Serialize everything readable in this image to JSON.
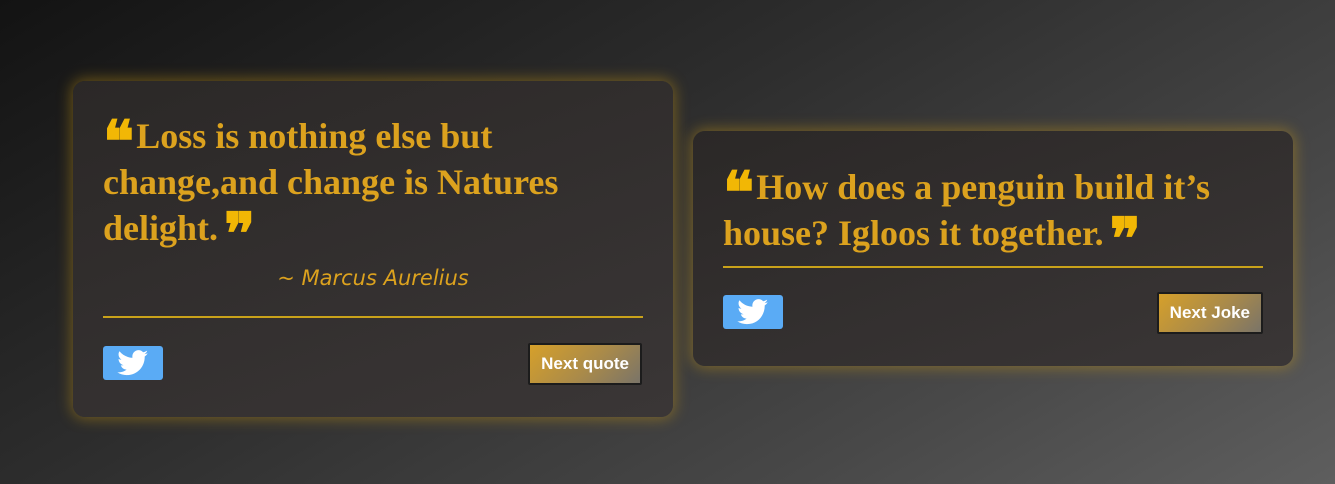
{
  "quote_card": {
    "open_mark": "❝",
    "text": "Loss is nothing else but change,and change is Natures delight.",
    "close_mark": "❞",
    "author": "~ Marcus Aurelius",
    "tweet_icon": "twitter-icon",
    "next_label": "Next quote"
  },
  "joke_card": {
    "open_mark": "❝",
    "text": "How does a penguin build it’s house? Igloos it together.",
    "close_mark": "❞",
    "tweet_icon": "twitter-icon",
    "next_label": "Next Joke"
  },
  "colors": {
    "accent_text": "#dca21e",
    "quote_mark": "#f2b705",
    "twitter_blue": "#5aabf5",
    "card_glow": "#c8961480"
  }
}
